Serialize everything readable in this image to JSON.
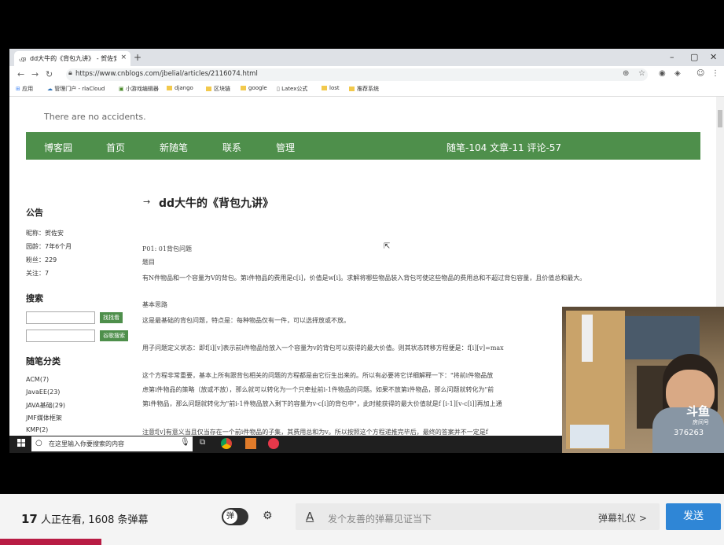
{
  "browser": {
    "tab_title": "dd大牛的《背包九讲》 - 贺佐安",
    "tab_close": "×",
    "new_tab": "+",
    "url": "https://www.cnblogs.com/jbelial/articles/2116074.html",
    "bookmarks": [
      "应用",
      "管理门户 - rlaCloud",
      "小游戏编辑器",
      "django",
      "区块链",
      "google",
      "Latex公式",
      "lost",
      "推荐系统"
    ]
  },
  "blog": {
    "subtitle": "There are no accidents.",
    "nav": [
      "博客园",
      "首页",
      "新随笔",
      "联系",
      "管理"
    ],
    "stats": "随笔-104  文章-11  评论-57",
    "notice_title": "公告",
    "profile": [
      "昵称：贺佐安",
      "园龄：7年6个月",
      "粉丝：229",
      "关注：7"
    ],
    "search_title": "搜索",
    "search_btn": "找找看",
    "google_btn": "谷歌搜索",
    "category_title": "随笔分类",
    "categories": [
      "ACM(7)",
      "JavaEE(23)",
      "JAVA基础(29)",
      "JMF媒体框架",
      "KMP(2)"
    ]
  },
  "article": {
    "title": "dd大牛的《背包九讲》",
    "lines": [
      "P01: 01背包问题",
      "题目",
      "有N件物品和一个容量为V的背包。第i件物品的费用是c[i]，价值是w[i]。求解将哪些物品装入背包可使这些物品的费用总和不超过背包容量，且价值总和最大。",
      "基本思路",
      "这是最基础的背包问题，特点是：每种物品仅有一件，可以选择放或不放。",
      "用子问题定义状态：即f[i][v]表示前i件物品恰放入一个容量为v的背包可以获得的最大价值。则其状态转移方程便是：f[i][v]=max",
      "这个方程非常重要，基本上所有跟背包相关的问题的方程都是由它衍生出来的。所以有必要将它详细解释一下：\"将前i件物品放",
      "虑第i件物品的策略（放或不放），那么就可以转化为一个只牵扯前i-1件物品的问题。如果不放第i件物品，那么问题就转化为\"前",
      "第i件物品，那么问题就转化为\"前i-1件物品放入剩下的容量为v-c[i]的背包中\"，此时能获得的最大价值就是f [i-1][v-c[i]]再加上通",
      "注意f[v]有意义当且仅当存在一个前i件物品的子集，其费用总和为v。所以按照这个方程递推完毕后，最终的答案并不一定是f"
    ]
  },
  "taskbar": {
    "search_placeholder": "在这里输入你要搜索的内容"
  },
  "webcam": {
    "watermark": "斗鱼",
    "room_label": "房间号",
    "room_number": "376263"
  },
  "footer": {
    "viewer_count": "17",
    "viewer_text": "人正在看,",
    "danmu_count": "1608",
    "danmu_text": "条弹幕",
    "toggle_label": "弹",
    "danmu_placeholder": "发个友善的弹幕见证当下",
    "etiquette": "弹幕礼仪 >",
    "send": "发送"
  }
}
